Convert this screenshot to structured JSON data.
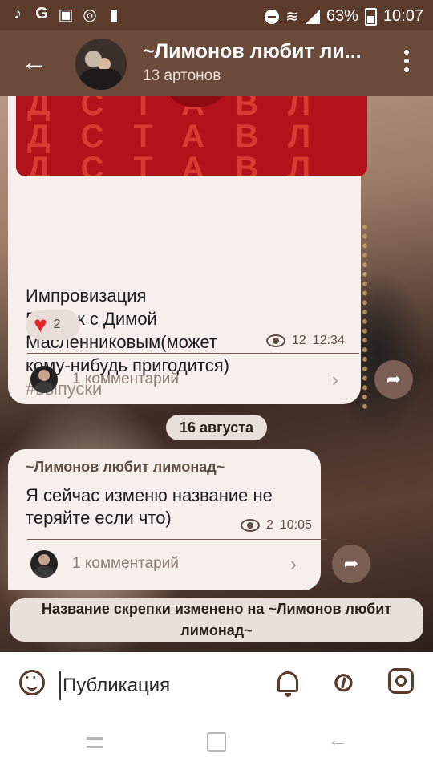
{
  "status_bar": {
    "battery": "63%",
    "time": "10:07"
  },
  "header": {
    "title": "~Лимонов любит ли...",
    "subtitle": "13 артонов"
  },
  "post1": {
    "image_letters": [
      "ДСТАВЛ",
      "ДСТАВЛ",
      "ДСТАВЛ"
    ],
    "text_lines": [
      "Импровизация",
      "Выпуск с Димой",
      "Масленниковым(может",
      "кому-нибудь пригодится)"
    ],
    "hashtag": "#выпуски",
    "reaction_count": "2",
    "views": "12",
    "time": "12:34",
    "comments": "1 комментарий"
  },
  "date_divider": "16 августа",
  "post2": {
    "author": "~Лимонов любит лимонад~",
    "text_lines": [
      "Я сейчас изменю название не",
      "теряйте если что)"
    ],
    "views": "2",
    "time": "10:05",
    "comments": "1 комментарий"
  },
  "service_message": "Название скрепки изменено на ~Лимонов любит лимонад~",
  "composer": {
    "placeholder": "Публикация"
  },
  "icons": {
    "back": "arrow-left-icon",
    "menu": "more-vertical-icon",
    "emoji": "smile-icon",
    "bell": "bell-icon",
    "attach": "paperclip-icon",
    "instagram": "instagram-icon",
    "share": "share-icon",
    "heart": "heart-icon",
    "eye": "eye-icon"
  },
  "colors": {
    "header": "#6a4a39",
    "status_bar": "#5a3b2c",
    "bubble": "#f6efec",
    "share_button": "#7b5e54",
    "heart": "#e0262b"
  }
}
